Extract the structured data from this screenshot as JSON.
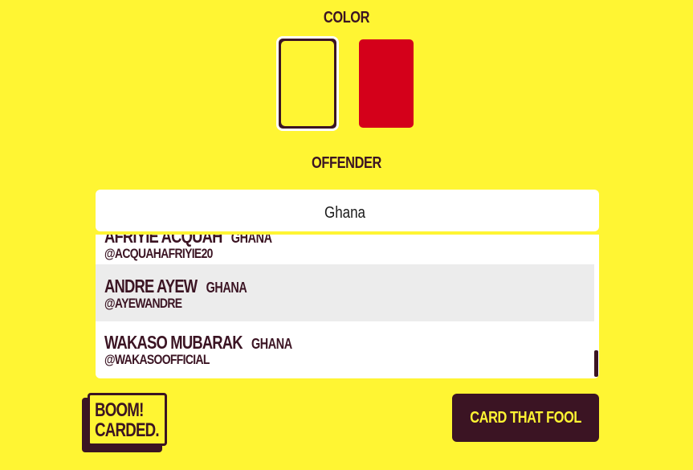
{
  "color_section": {
    "title": "COLOR",
    "options": [
      {
        "name": "yellow",
        "hex": "#fff533",
        "selected": true
      },
      {
        "name": "red",
        "hex": "#d4001a",
        "selected": false
      }
    ]
  },
  "offender_section": {
    "title": "OFFENDER",
    "search_value": "Ghana",
    "results": [
      {
        "name": "AFRIYIE ACQUAH",
        "country": "GHANA",
        "handle": "@ACQUAHAFRIYIE20",
        "highlighted": false
      },
      {
        "name": "ANDRE AYEW",
        "country": "GHANA",
        "handle": "@AYEWANDRE",
        "highlighted": true
      },
      {
        "name": "WAKASO MUBARAK",
        "country": "GHANA",
        "handle": "@WAKASOOFFICIAL",
        "highlighted": false
      }
    ]
  },
  "logo": {
    "line1": "BOOM!",
    "line2": "CARDED."
  },
  "actions": {
    "submit_label": "CARD THAT FOOL"
  },
  "colors": {
    "background": "#fff533",
    "dark": "#3b1423",
    "red": "#d4001a"
  }
}
